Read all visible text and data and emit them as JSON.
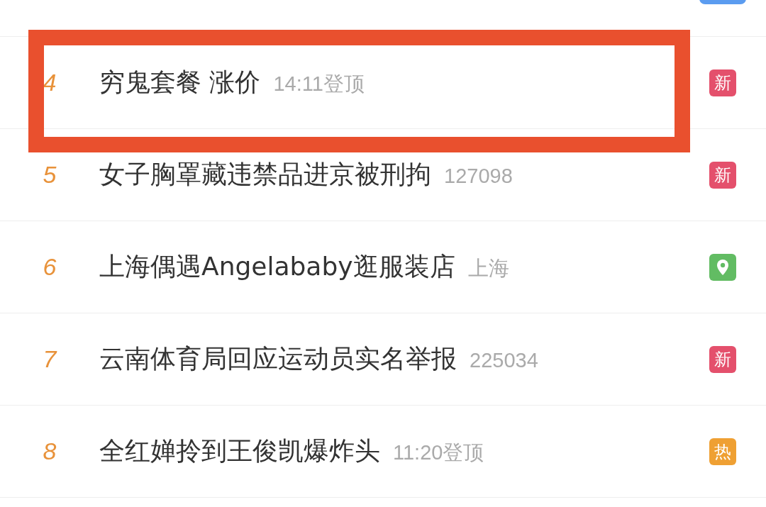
{
  "top_row": {
    "badge": {
      "color": "#5b9cf0"
    }
  },
  "items": [
    {
      "rank": "4",
      "title": "穷鬼套餐 涨价",
      "meta": "14:11登顶",
      "badge": {
        "kind": "new",
        "label": "新"
      },
      "highlighted": true
    },
    {
      "rank": "5",
      "title": "女子胸罩藏违禁品进京被刑拘",
      "meta": "127098",
      "badge": {
        "kind": "new",
        "label": "新"
      },
      "highlighted": false
    },
    {
      "rank": "6",
      "title": "上海偶遇Angelababy逛服装店",
      "meta": "上海",
      "badge": {
        "kind": "location"
      },
      "highlighted": false
    },
    {
      "rank": "7",
      "title": "云南体育局回应运动员实名举报",
      "meta": "225034",
      "badge": {
        "kind": "new",
        "label": "新"
      },
      "highlighted": false
    },
    {
      "rank": "8",
      "title": "全红婵拎到王俊凯爆炸头",
      "meta": "11:20登顶",
      "badge": {
        "kind": "hot",
        "label": "热"
      },
      "highlighted": false
    }
  ]
}
